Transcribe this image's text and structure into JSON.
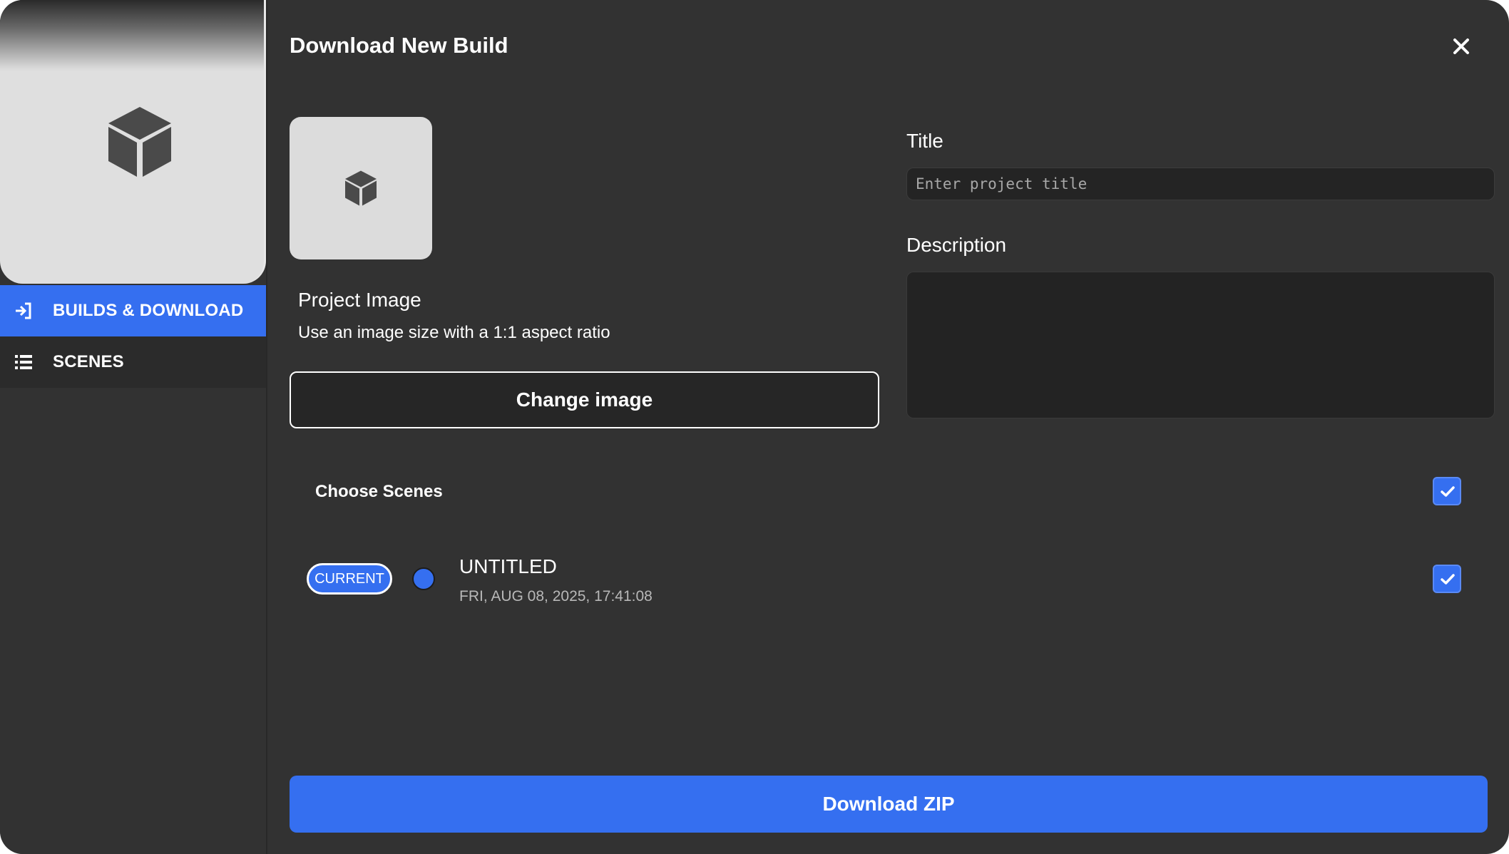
{
  "sidebar": {
    "thumbnail_icon": "cube-icon",
    "items": [
      {
        "label": "BUILDS & DOWNLOAD",
        "icon": "sign-in-icon",
        "active": true
      },
      {
        "label": "SCENES",
        "icon": "list-icon",
        "active": false
      }
    ]
  },
  "header": {
    "title": "Download New Build",
    "close_icon": "close-icon"
  },
  "project_image": {
    "icon": "cube-icon",
    "label": "Project Image",
    "hint": "Use an image size with a 1:1 aspect ratio",
    "change_button": "Change image"
  },
  "form": {
    "title_label": "Title",
    "title_value": "",
    "title_placeholder": "Enter project title",
    "description_label": "Description",
    "description_value": ""
  },
  "scenes": {
    "heading": "Choose Scenes",
    "select_all_checked": true,
    "items": [
      {
        "badge": "CURRENT",
        "name": "UNTITLED",
        "date": "FRI, AUG 08, 2025, 17:41:08",
        "checked": true
      }
    ]
  },
  "footer": {
    "download_button": "Download ZIP"
  },
  "colors": {
    "accent": "#356ff0",
    "background": "#323232",
    "input_background": "#232323"
  }
}
